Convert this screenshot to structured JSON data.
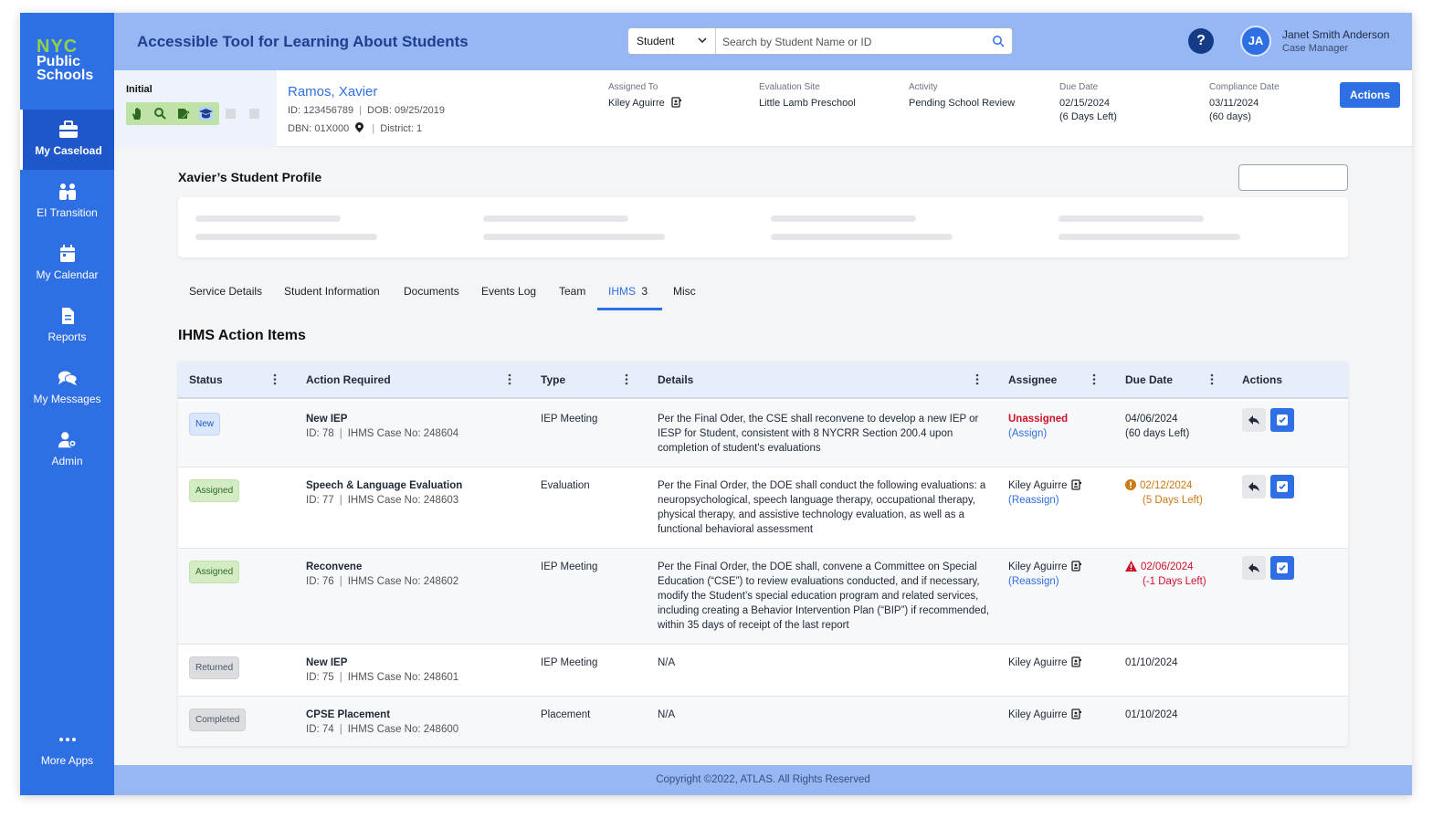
{
  "app": {
    "title": "Accessible Tool for Learning About Students",
    "logo_line1": "NYC",
    "logo_line2": "Public",
    "logo_line3": "Schools"
  },
  "sidebar": {
    "items": [
      {
        "label": "My Caseload",
        "icon": "briefcase-icon",
        "active": true
      },
      {
        "label": "EI Transition",
        "icon": "family-icon"
      },
      {
        "label": "My Calendar",
        "icon": "calendar-icon"
      },
      {
        "label": "Reports",
        "icon": "document-icon"
      },
      {
        "label": "My Messages",
        "icon": "chat-icon"
      },
      {
        "label": "Admin",
        "icon": "user-gear-icon"
      }
    ],
    "more_apps": "More Apps"
  },
  "search": {
    "scope": "Student",
    "placeholder": "Search by Student Name or ID"
  },
  "user": {
    "initials": "JA",
    "name": "Janet Smith Anderson",
    "role": "Case Manager",
    "help": "?"
  },
  "student": {
    "stage": "Initial",
    "name": "Ramos, Xavier",
    "id": "ID: 123456789",
    "dob": "DOB: 09/25/2019",
    "dbn": "DBN: 01X000",
    "district": "District: 1",
    "assigned_to_label": "Assigned To",
    "assigned_to": "Kiley Aguirre",
    "eval_site_label": "Evaluation Site",
    "eval_site": "Little Lamb Preschool",
    "activity_label": "Activity",
    "activity": "Pending School Review",
    "due_date_label": "Due Date",
    "due_date": "02/15/2024",
    "due_date_note": "(6 Days Left)",
    "compliance_label": "Compliance Date",
    "compliance_date": "03/11/2024",
    "compliance_note": "(60 days)",
    "actions_label": "Actions"
  },
  "profile": {
    "title": "Xavier’s Student Profile"
  },
  "tabs": [
    {
      "label": "Service Details"
    },
    {
      "label": "Student Information"
    },
    {
      "label": "Documents"
    },
    {
      "label": "Events Log"
    },
    {
      "label": "Team"
    },
    {
      "label": "IHMS",
      "count": "3",
      "active": true
    },
    {
      "label": "Misc"
    }
  ],
  "section_title": "IHMS Action Items",
  "table": {
    "headers": [
      "Status",
      "Action Required",
      "Type",
      "Details",
      "Assignee",
      "Due Date",
      "Actions"
    ],
    "rows": [
      {
        "status": "New",
        "action": "New IEP",
        "id": "ID: 78",
        "case": "IHMS Case No: 248604",
        "type": "IEP Meeting",
        "details": "Per the Final Oder, the CSE shall reconvene to develop a new IEP or IESP for Student, consistent with 8 NYCRR Section 200.4 upon completion of student's evaluations",
        "assignee": "Unassigned",
        "assignee_link": "(Assign)",
        "due": "04/06/2024",
        "due_note": "(60 days Left)"
      },
      {
        "status": "Assigned",
        "action": "Speech & Language Evaluation",
        "id": "ID: 77",
        "case": "IHMS Case No: 248603",
        "type": "Evaluation",
        "details": "Per the Final Order, the DOE shall conduct the following evaluations: a neuropsychological, speech language therapy, occupational therapy, physical therapy, and assistive technology evaluation, as well as a functional behavioral assessment",
        "assignee": "Kiley Aguirre",
        "assignee_link": "(Reassign)",
        "due": "02/12/2024",
        "due_note": "(5 Days Left)"
      },
      {
        "status": "Assigned",
        "action": "Reconvene",
        "id": "ID: 76",
        "case": "IHMS Case No: 248602",
        "type": "IEP Meeting",
        "details": "Per the Final Order, the DOE shall, convene a Committee on Special Education (“CSE”) to review evaluations conducted, and if necessary, modify the Student’s special education program and related services, including creating a Behavior Intervention Plan (“BIP”) if recommended, within 35 days of receipt of the last report",
        "assignee": "Kiley Aguirre",
        "assignee_link": "(Reassign)",
        "due": "02/06/2024",
        "due_note": "(-1 Days Left)"
      },
      {
        "status": "Returned",
        "action": "New IEP",
        "id": "ID: 75",
        "case": "IHMS Case No: 248601",
        "type": "IEP Meeting",
        "details": "N/A",
        "assignee": "Kiley Aguirre",
        "due": "01/10/2024"
      },
      {
        "status": "Completed",
        "action": "CPSE Placement",
        "id": "ID: 74",
        "case": "IHMS Case No: 248600",
        "type": "Placement",
        "details": "N/A",
        "assignee": "Kiley Aguirre",
        "due": "01/10/2024"
      }
    ]
  },
  "footer": "Copyright ©2022, ATLAS. All Rights Reserved",
  "colors": {
    "primary": "#2f6fe4",
    "header_bg": "#96b7f4",
    "danger": "#d0112b",
    "warning": "#c97a14"
  }
}
